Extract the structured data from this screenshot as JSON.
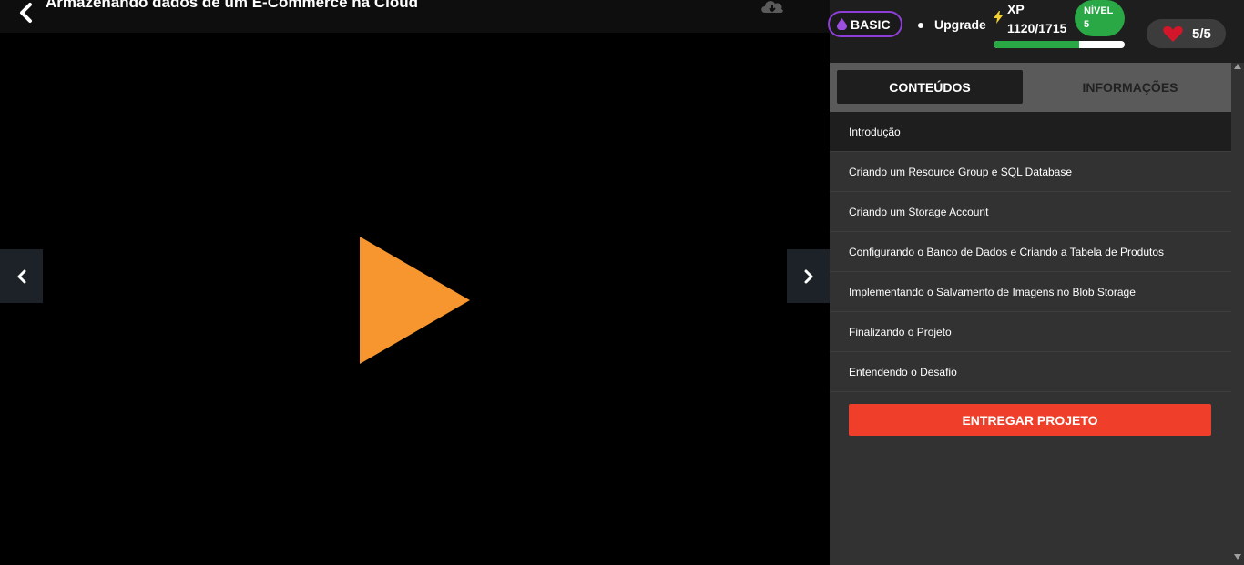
{
  "video": {
    "title": "Armazenando dados de um E-Commerce na Cloud",
    "icons": {
      "back": "chevron-left-icon",
      "download": "cloud-download-icon",
      "play": "play-icon",
      "prev": "chevron-left-icon",
      "next": "chevron-right-icon"
    },
    "play_color": "#f7962e"
  },
  "header": {
    "plan_label": "BASIC",
    "upgrade_label": "Upgrade",
    "xp_label": "XP",
    "xp_value": "1120/1715",
    "xp_progress": 0.65,
    "level_label": "NÍVEL",
    "level_value": "5",
    "lives": "5/5",
    "colors": {
      "plan_border": "#8e3ed6",
      "level": "#2aa845",
      "heart": "#d3162a"
    }
  },
  "tabs": [
    {
      "label": "CONTEÚDOS",
      "active": true
    },
    {
      "label": "INFORMAÇÕES",
      "active": false
    }
  ],
  "lessons": [
    {
      "label": "Introdução",
      "active": true
    },
    {
      "label": "Criando um Resource Group e SQL Database",
      "active": false
    },
    {
      "label": "Criando um Storage Account",
      "active": false
    },
    {
      "label": "Configurando o Banco de Dados e Criando a Tabela de Produtos",
      "active": false
    },
    {
      "label": "Implementando o Salvamento de Imagens no Blob Storage",
      "active": false
    },
    {
      "label": "Finalizando o Projeto",
      "active": false
    },
    {
      "label": "Entendendo o Desafio",
      "active": false
    }
  ],
  "deliver_button": {
    "label": "ENTREGAR PROJETO",
    "color": "#ef3f2a"
  }
}
